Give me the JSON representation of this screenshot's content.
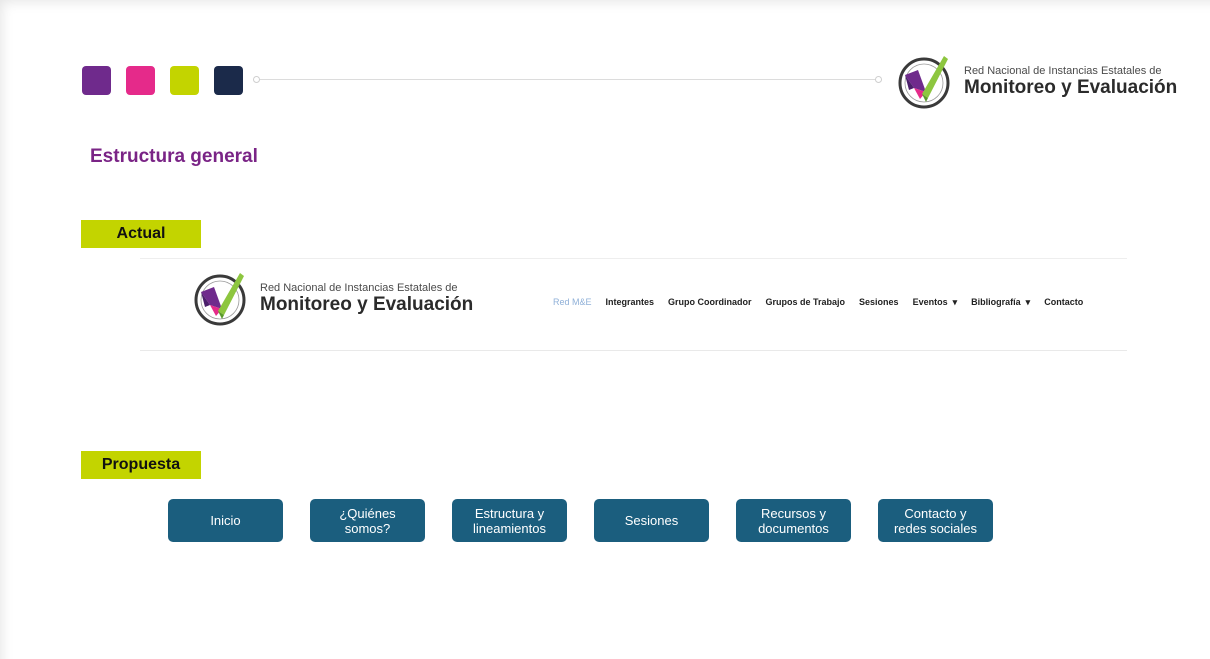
{
  "colors": {
    "purple": "#6f2a8c",
    "magenta": "#e52a8a",
    "lime": "#c3d400",
    "navy": "#1b2a4a",
    "title_purple": "#7a2486",
    "button_blue": "#1b5e7e"
  },
  "header": {
    "logo_line1": "Red Nacional de Instancias Estatales de",
    "logo_line2": "Monitoreo y Evaluación"
  },
  "section_title": "Estructura general",
  "actual": {
    "tag": "Actual",
    "logo_line1": "Red Nacional de Instancias Estatales de",
    "logo_line2": "Monitoreo y Evaluación",
    "nav": [
      {
        "label": "Red M&E"
      },
      {
        "label": "Integrantes"
      },
      {
        "label": "Grupo Coordinador"
      },
      {
        "label": "Grupos de Trabajo"
      },
      {
        "label": "Sesiones"
      },
      {
        "label": "Eventos",
        "caret": "▾"
      },
      {
        "label": "Bibliografía",
        "caret": "▾"
      },
      {
        "label": "Contacto"
      }
    ]
  },
  "propuesta": {
    "tag": "Propuesta",
    "buttons": [
      "Inicio",
      "¿Quiénes\nsomos?",
      "Estructura y\nlineamientos",
      "Sesiones",
      "Recursos y\ndocumentos",
      "Contacto y\nredes sociales"
    ]
  }
}
